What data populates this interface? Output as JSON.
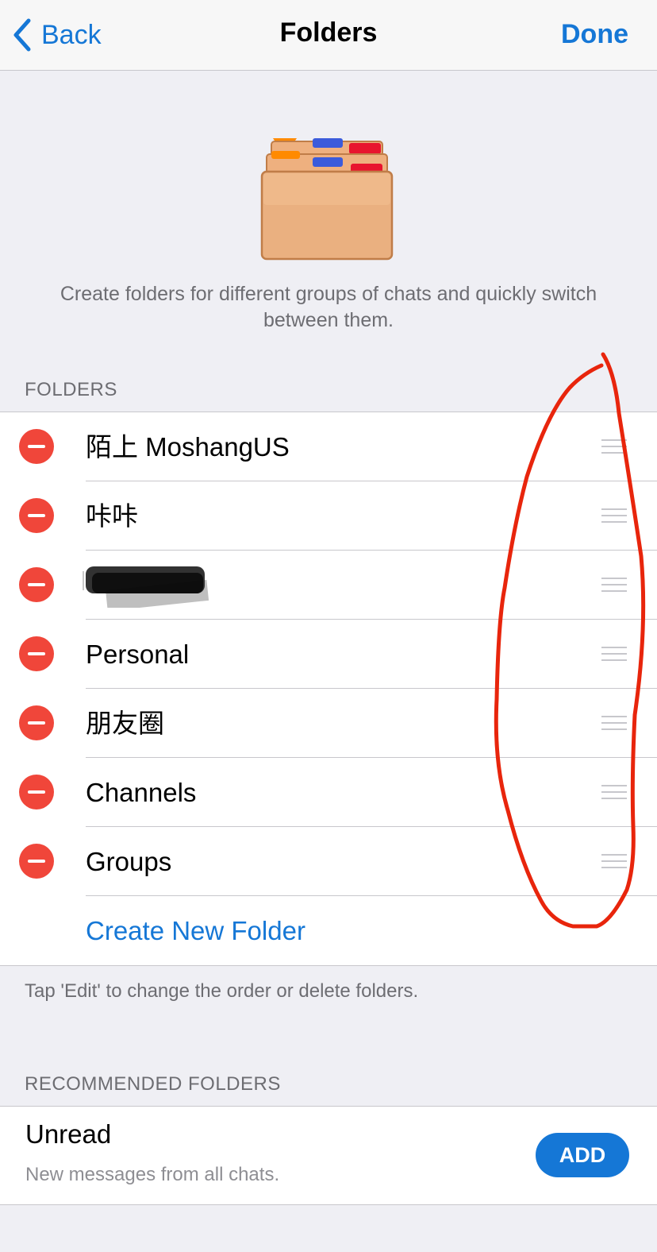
{
  "nav": {
    "back_label": "Back",
    "title": "Folders",
    "done_label": "Done"
  },
  "hero": {
    "icon": "folders-icon",
    "text": "Create folders for different groups of chats and quickly switch between them."
  },
  "folders_section": {
    "header": "FOLDERS",
    "items": [
      {
        "label": "陌上 MoshangUS"
      },
      {
        "label": "咔咔"
      },
      {
        "label": ""
      },
      {
        "label": "Personal"
      },
      {
        "label": "朋友圈"
      },
      {
        "label": "Channels"
      },
      {
        "label": "Groups"
      }
    ],
    "create_label": "Create New Folder",
    "footer": "Tap 'Edit' to change the order or delete folders."
  },
  "recommended_section": {
    "header": "RECOMMENDED FOLDERS",
    "item": {
      "title": "Unread",
      "subtitle": "New messages from all chats.",
      "add_label": "ADD"
    }
  },
  "colors": {
    "accent": "#1577d6",
    "delete": "#f0463a",
    "annotation": "#e8250c",
    "background": "#efeff4"
  }
}
